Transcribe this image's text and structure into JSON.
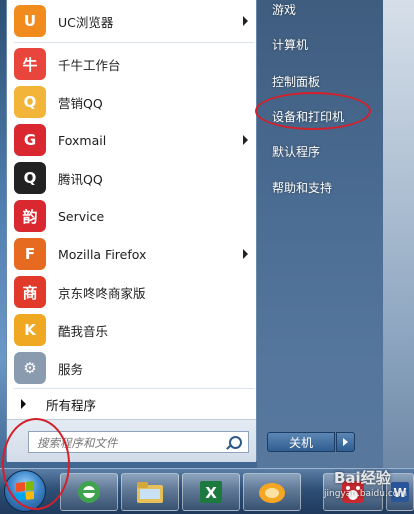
{
  "programs": [
    {
      "label": "UC浏览器",
      "icon": "uc-browser-icon",
      "color": "#f28b1e",
      "glyph": "U",
      "has_arrow": true
    },
    {
      "label": "千牛工作台",
      "icon": "qianniu-icon",
      "color": "#e8453c",
      "glyph": "牛",
      "has_arrow": false
    },
    {
      "label": "营销QQ",
      "icon": "marketing-qq-icon",
      "color": "#f2b53a",
      "glyph": "Q",
      "has_arrow": false
    },
    {
      "label": "Foxmail",
      "icon": "foxmail-icon",
      "color": "#d9282f",
      "glyph": "G",
      "has_arrow": true
    },
    {
      "label": "腾讯QQ",
      "icon": "tencent-qq-icon",
      "color": "#222222",
      "glyph": "Q",
      "has_arrow": false
    },
    {
      "label": "Service",
      "icon": "service-icon",
      "color": "#d9282f",
      "glyph": "韵",
      "has_arrow": false
    },
    {
      "label": "Mozilla Firefox",
      "icon": "firefox-icon",
      "color": "#e66a1f",
      "glyph": "F",
      "has_arrow": true
    },
    {
      "label": "京东咚咚商家版",
      "icon": "jd-dongdong-icon",
      "color": "#e23a2a",
      "glyph": "商",
      "has_arrow": false
    },
    {
      "label": "酷我音乐",
      "icon": "kuwo-music-icon",
      "color": "#f0a822",
      "glyph": "K",
      "has_arrow": false
    },
    {
      "label": "服务",
      "icon": "services-gear-icon",
      "color": "#8a9bb0",
      "glyph": "⚙",
      "has_arrow": false
    }
  ],
  "all_programs": "所有程序",
  "search": {
    "placeholder": "搜索程序和文件"
  },
  "right_items": [
    "游戏",
    "计算机",
    "控制面板",
    "设备和打印机",
    "默认程序",
    "帮助和支持"
  ],
  "shutdown_label": "关机",
  "watermark": {
    "main": "Bai经验",
    "sub": "jingyan.baidu.com"
  },
  "colors": {
    "highlight": "#d3202a"
  }
}
